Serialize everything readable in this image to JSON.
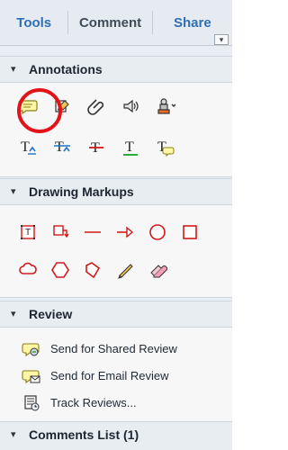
{
  "tabs": [
    {
      "label": "Tools"
    },
    {
      "label": "Comment"
    },
    {
      "label": "Share"
    }
  ],
  "menu_button": {
    "label": "▾"
  },
  "sections": [
    {
      "title": "Annotations",
      "icons_row1": [
        "sticky-note",
        "text-edit",
        "attach-file",
        "record-audio",
        "stamp"
      ],
      "icons_row2": [
        "insert-text",
        "replace-text",
        "strikethrough",
        "underline",
        "add-note-to-text"
      ]
    },
    {
      "title": "Drawing Markups",
      "icons_row1": [
        "text-box",
        "callout",
        "line",
        "arrow",
        "oval",
        "rectangle"
      ],
      "icons_row2": [
        "cloud",
        "polygon",
        "polyline",
        "pencil",
        "eraser"
      ]
    },
    {
      "title": "Review",
      "items": [
        {
          "label": "Send for Shared Review",
          "icon": "shared-review-icon"
        },
        {
          "label": "Send for Email Review",
          "icon": "email-review-icon"
        },
        {
          "label": "Track Reviews...",
          "icon": "track-reviews-icon"
        }
      ]
    },
    {
      "title": "Comments List (1)"
    }
  ]
}
